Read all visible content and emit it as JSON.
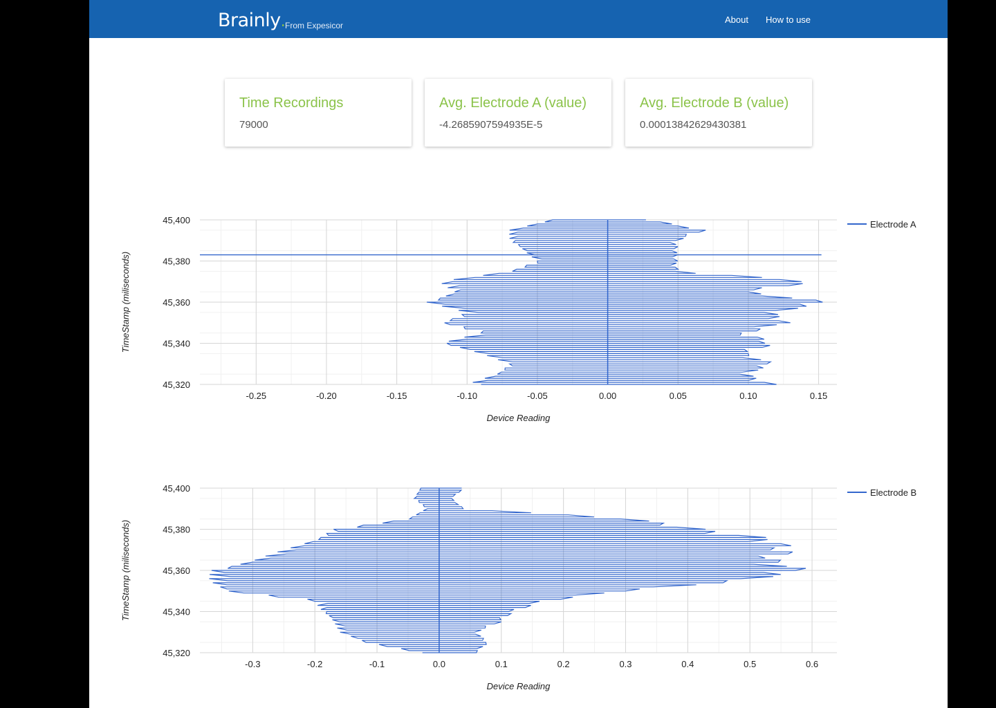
{
  "header": {
    "brand": "Brainly",
    "brand_dot": ".",
    "tagline": "From Expesicor",
    "nav": [
      {
        "label": "About"
      },
      {
        "label": "How to use"
      }
    ]
  },
  "cards": [
    {
      "title": "Time Recordings",
      "value": "79000"
    },
    {
      "title": "Avg. Electrode A (value)",
      "value": "-4.2685907594935E-5"
    },
    {
      "title": "Avg. Electrode B (value)",
      "value": "0.00013842629430381"
    }
  ],
  "colors": {
    "navbar": "#1663b0",
    "accent": "#8bc34a",
    "series": "#3366cc"
  },
  "chart_data": [
    {
      "type": "line",
      "orientation": "horizontal",
      "xlabel": "Device Reading",
      "ylabel": "TimeStamp (miliseconds)",
      "xlim": [
        -0.29,
        0.163
      ],
      "ylim": [
        45320,
        45400
      ],
      "xticks": [
        -0.25,
        -0.2,
        -0.15,
        -0.1,
        -0.05,
        0.0,
        0.05,
        0.1,
        0.15
      ],
      "xtick_labels": [
        "-0.25",
        "-0.20",
        "-0.15",
        "-0.10",
        "-0.05",
        "0.00",
        "0.05",
        "0.10",
        "0.15"
      ],
      "yticks": [
        45320,
        45340,
        45360,
        45380,
        45400
      ],
      "ytick_labels": [
        "45,320",
        "45,340",
        "45,360",
        "45,380",
        "45,400"
      ],
      "grid": true,
      "legend": "top-right",
      "series": [
        {
          "name": "Electrode A",
          "color": "#3366cc",
          "t_start": 45320,
          "t_end": 45400,
          "envelope_t": [
            45320,
            45325,
            45330,
            45335,
            45340,
            45345,
            45350,
            45355,
            45360,
            45365,
            45370,
            45375,
            45380,
            45385,
            45390,
            45395,
            45400
          ],
          "envelope_min": [
            -0.1,
            -0.08,
            -0.07,
            -0.09,
            -0.12,
            -0.09,
            -0.12,
            -0.1,
            -0.13,
            -0.11,
            -0.12,
            -0.07,
            -0.05,
            -0.06,
            -0.07,
            -0.07,
            -0.04
          ],
          "envelope_max": [
            0.12,
            0.1,
            0.12,
            0.1,
            0.12,
            0.1,
            0.13,
            0.12,
            0.16,
            0.1,
            0.15,
            0.05,
            0.05,
            0.05,
            0.05,
            0.07,
            0.03
          ],
          "outliers": [
            {
              "t": 45383,
              "x": [
                -0.29,
                0.152
              ]
            }
          ]
        }
      ]
    },
    {
      "type": "line",
      "orientation": "horizontal",
      "xlabel": "Device Reading",
      "ylabel": "TimeStamp (miliseconds)",
      "xlim": [
        -0.385,
        0.64
      ],
      "ylim": [
        45320,
        45400
      ],
      "xticks": [
        -0.3,
        -0.2,
        -0.1,
        0.0,
        0.1,
        0.2,
        0.3,
        0.4,
        0.5,
        0.6
      ],
      "xtick_labels": [
        "-0.3",
        "-0.2",
        "-0.1",
        "0.0",
        "0.1",
        "0.2",
        "0.3",
        "0.4",
        "0.5",
        "0.6"
      ],
      "yticks": [
        45320,
        45340,
        45360,
        45380,
        45400
      ],
      "ytick_labels": [
        "45,320",
        "45,340",
        "45,360",
        "45,380",
        "45,400"
      ],
      "grid": true,
      "legend": "top-right",
      "series": [
        {
          "name": "Electrode B",
          "color": "#3366cc",
          "t_start": 45320,
          "t_end": 45400,
          "envelope_t": [
            45320,
            45325,
            45330,
            45335,
            45340,
            45345,
            45350,
            45355,
            45360,
            45365,
            45370,
            45375,
            45380,
            45385,
            45390,
            45395,
            45400
          ],
          "envelope_min": [
            -0.03,
            -0.12,
            -0.16,
            -0.17,
            -0.19,
            -0.2,
            -0.35,
            -0.37,
            -0.37,
            -0.3,
            -0.25,
            -0.2,
            -0.17,
            -0.05,
            -0.02,
            -0.04,
            -0.03
          ],
          "envelope_max": [
            0.06,
            0.08,
            0.06,
            0.1,
            0.12,
            0.17,
            0.3,
            0.5,
            0.6,
            0.55,
            0.58,
            0.55,
            0.43,
            0.32,
            0.04,
            0.02,
            0.04
          ]
        }
      ]
    }
  ]
}
